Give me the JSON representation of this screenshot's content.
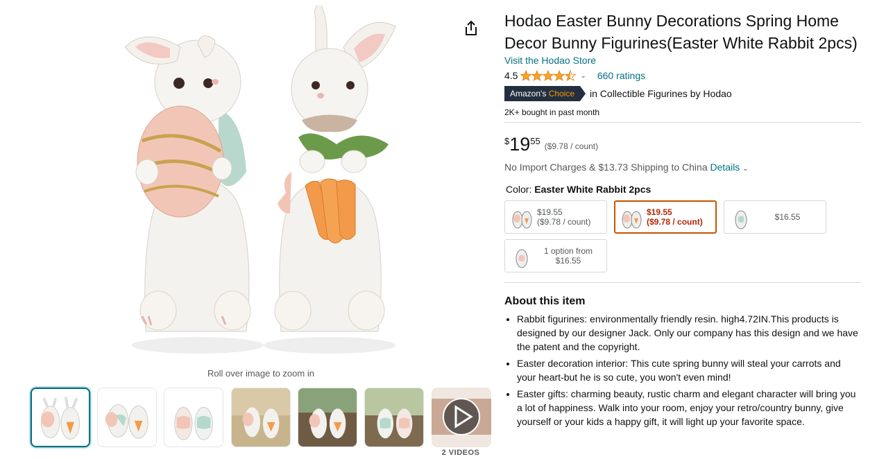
{
  "gallery": {
    "zoom_hint": "Roll over image to zoom in",
    "videos_label": "2 VIDEOS",
    "share_icon": "share-icon",
    "thumbnails": [
      "bunnies-front",
      "bunnies-side",
      "bunnies-back",
      "bunnies-table",
      "bunnies-outdoor",
      "bunnies-garden",
      "video"
    ]
  },
  "product": {
    "title": "Hodao Easter Bunny Decorations Spring Home Decor Bunny Figurines(Easter White Rabbit 2pcs)",
    "store_link": "Visit the Hodao Store",
    "rating_value": "4.5",
    "rating_stars": 4.5,
    "ratings_count": "660 ratings",
    "badge_prefix": "Amazon's",
    "badge_choice": "Choice",
    "badge_category": "in Collectible Figurines by Hodao",
    "bought": "2K+ bought in past month",
    "price_symbol": "$",
    "price_whole": "19",
    "price_fraction": "55",
    "price_unit": "($9.78 / count)",
    "shipping_text": "No Import Charges & $13.73 Shipping to China",
    "shipping_details": "Details",
    "color_label": "Color:",
    "color_value": "Easter White Rabbit 2pcs",
    "swatches": [
      {
        "line1": "$19.55",
        "line2": "($9.78 / count)"
      },
      {
        "line1": "$19.55",
        "line2": "($9.78 / count)"
      },
      {
        "line1": "$16.55",
        "line2": ""
      },
      {
        "line1": "1 option from",
        "line2": "$16.55"
      }
    ],
    "about_heading": "About this item",
    "bullets": [
      "Rabbit figurines: environmentally friendly resin. high4.72IN.This products is designed by our designer Jack. Only our company has this design and we have the patent and the copyright.",
      "Easter decoration interior: This cute spring bunny will steal your carrots and your heart-but he is so cute, you won't even mind!",
      "Easter gifts: charming beauty, rustic charm and elegant character will bring you a lot of happiness. Walk into your room, enjoy your retro/country bunny, give yourself or your kids a happy gift, it will light up your favorite space."
    ]
  },
  "colors": {
    "link": "#007185",
    "badge_bg": "#232f3e",
    "badge_accent": "#ff9900",
    "star": "#ffa41c",
    "selected_border": "#c45500",
    "selected_price": "#b12704"
  }
}
